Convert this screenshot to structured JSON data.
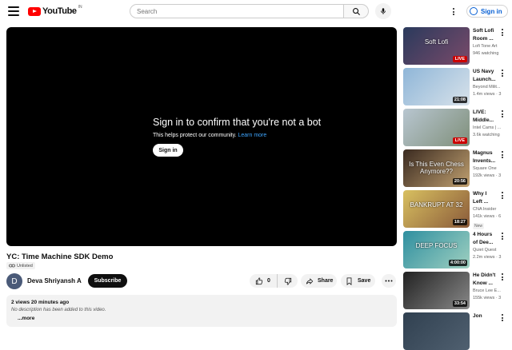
{
  "header": {
    "logo_text": "YouTube",
    "logo_country": "IN",
    "search_placeholder": "Search",
    "signin_label": "Sign in"
  },
  "player": {
    "heading": "Sign in to confirm that you're not a bot",
    "subtext": "This helps protect our community.",
    "learn_more": "Learn more",
    "signin_button": "Sign in"
  },
  "video": {
    "title": "YC: Time Machine SDK Demo",
    "visibility": "Unlisted",
    "channel_initial": "D",
    "channel_name": "Deva Shriyansh A",
    "subscribe_label": "Subscribe",
    "like_count": "0",
    "share_label": "Share",
    "save_label": "Save",
    "meta": "2 views  20 minutes ago",
    "description": "No description has been added to this video.",
    "more_label": "...more"
  },
  "recommendations": [
    {
      "title": "Soft Lofi\nRoom ...",
      "channel": "Lofi Tone Art",
      "stats": "946 watching",
      "badge": "LIVE",
      "live": true,
      "overlay": "Soft Lofi",
      "colors": [
        "#2a3a5c",
        "#7a4a6a"
      ]
    },
    {
      "title": "US Navy\nLaunch...",
      "channel": "Beyond Milit...",
      "stats": "1.4m views · 3",
      "badge": "21:08",
      "live": false,
      "overlay": "",
      "colors": [
        "#8fb6d8",
        "#d8e2ea"
      ]
    },
    {
      "title": "LIVE:\nMiddle...",
      "channel": "Intel Cams | ...",
      "stats": "3.6k watching",
      "badge": "LIVE",
      "live": true,
      "overlay": "",
      "colors": [
        "#b8c6d0",
        "#7f8f7a"
      ]
    },
    {
      "title": "Magnus\nInvents...",
      "channel": "Square One",
      "stats": "192k views · 3",
      "badge": "20:56",
      "live": false,
      "overlay": "Is This Even Chess Anymore??",
      "colors": [
        "#3a2a20",
        "#c0a070"
      ]
    },
    {
      "title": "Why I\nLeft ...",
      "channel": "CNA Insider",
      "stats": "141k views · 6",
      "badge": "18:27",
      "live": false,
      "overlay": "BANKRUPT AT 32",
      "colors": [
        "#d8c060",
        "#8a5a3a"
      ],
      "new": "New"
    },
    {
      "title": "4 Hours\nof Dee...",
      "channel": "Quiet Quest",
      "stats": "2.2m views · 3",
      "badge": "4:00:00",
      "live": false,
      "overlay": "DEEP FOCUS",
      "colors": [
        "#2f8fa0",
        "#9fd0c0"
      ]
    },
    {
      "title": "He Didn't\nKnow ...",
      "channel": "Bruce Lee E...",
      "stats": "155k views · 3",
      "badge": "33:54",
      "live": false,
      "overlay": "",
      "colors": [
        "#222222",
        "#888888"
      ]
    },
    {
      "title": "Jon",
      "channel": "",
      "stats": "",
      "badge": "",
      "live": false,
      "overlay": "",
      "colors": [
        "#304050",
        "#506070"
      ]
    }
  ],
  "colors": {
    "brand_red": "#ff0000",
    "link_blue": "#065fd4",
    "live_red": "#cc0000"
  }
}
